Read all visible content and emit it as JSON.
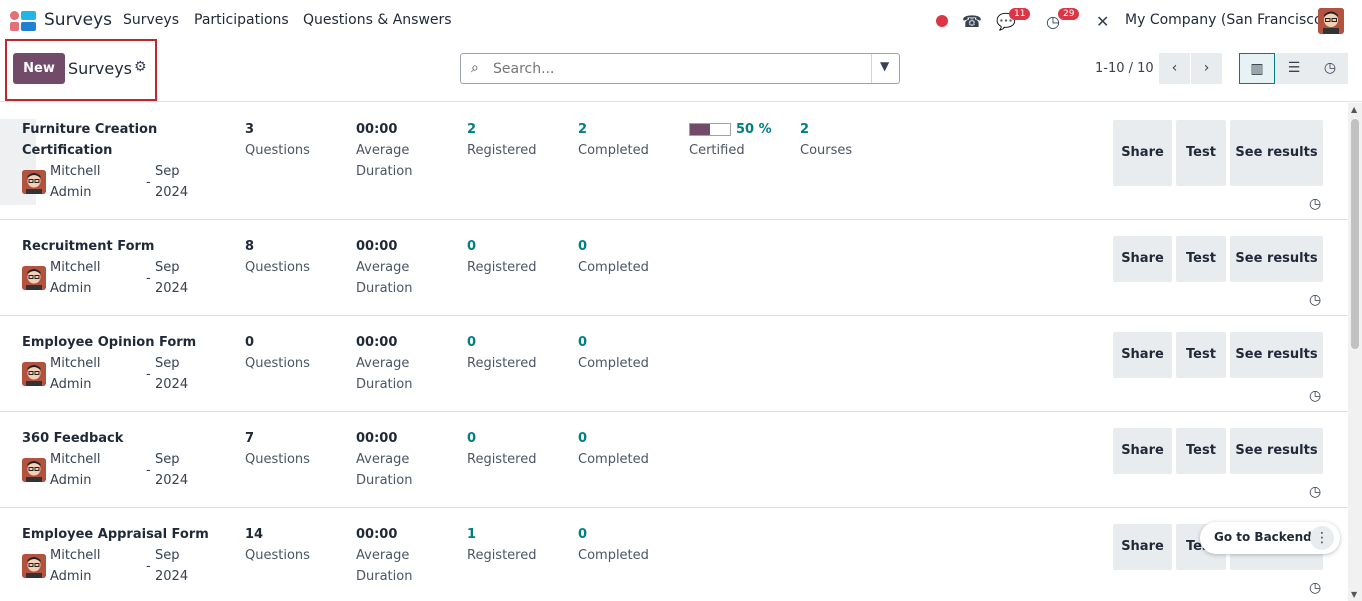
{
  "nav": {
    "app_name": "Surveys",
    "menu": [
      "Surveys",
      "Participations",
      "Questions & Answers"
    ],
    "messages_badge": "11",
    "activities_badge": "29",
    "company": "My Company (San Francisco)"
  },
  "control": {
    "new_label": "New",
    "breadcrumb": "Surveys",
    "search_placeholder": "Search...",
    "pager": "1-10 / 10"
  },
  "labels": {
    "questions": "Questions",
    "average": "Average",
    "duration": "Duration",
    "registered": "Registered",
    "completed": "Completed",
    "certified": "Certified",
    "courses": "Courses",
    "share": "Share",
    "test": "Test",
    "see_results": "See results",
    "owner_first": "Mitchell",
    "owner_last": "Admin",
    "month": "Sep",
    "year": "2024",
    "duration_value": "00:00"
  },
  "records": [
    {
      "title1": "Furniture Creation",
      "title2": "Certification",
      "questions": "3",
      "registered": "2",
      "completed": "2",
      "certified_pct": "50 %",
      "certified_ratio": 0.5,
      "courses": "2"
    },
    {
      "title1": "Recruitment Form",
      "questions": "8",
      "registered": "0",
      "completed": "0"
    },
    {
      "title1": "Employee Opinion Form",
      "questions": "0",
      "registered": "0",
      "completed": "0"
    },
    {
      "title1": "360 Feedback",
      "questions": "7",
      "registered": "0",
      "completed": "0"
    },
    {
      "title1": "Employee Appraisal Form",
      "questions": "14",
      "registered": "1",
      "completed": "0"
    }
  ],
  "backend": {
    "label": "Go to Backend"
  },
  "colors": {
    "brand": "#714b67",
    "teal": "#017e84",
    "highlight": "#c0282d"
  }
}
